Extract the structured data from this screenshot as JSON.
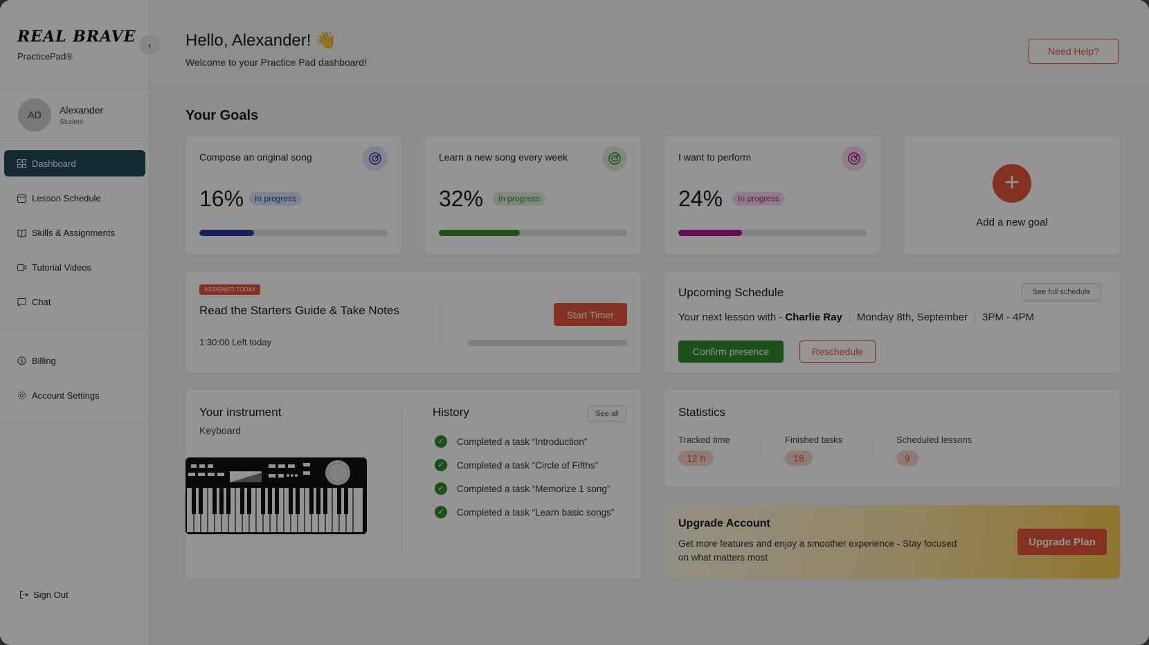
{
  "brand": {
    "logo": "REAL BRAVE",
    "product": "PracticePad®"
  },
  "user": {
    "initials": "AD",
    "name": "Alexander",
    "role": "Student"
  },
  "nav": {
    "items": [
      {
        "label": "Dashboard",
        "icon": "dashboard-icon",
        "active": true
      },
      {
        "label": "Lesson Schedule",
        "icon": "calendar-icon"
      },
      {
        "label": "Skills & Assignments",
        "icon": "book-icon"
      },
      {
        "label": "Tutorial Videos",
        "icon": "video-icon"
      },
      {
        "label": "Chat",
        "icon": "chat-icon"
      }
    ],
    "secondary": [
      {
        "label": "Billing",
        "icon": "billing-icon"
      },
      {
        "label": "Account Settings",
        "icon": "gear-icon"
      }
    ],
    "signout": "Sign Out"
  },
  "header": {
    "greeting": "Hello, Alexander! 👋",
    "welcome": "Welcome to your Practice Pad dashboard!",
    "help_label": "Need Help?"
  },
  "goals": {
    "title": "Your Goals",
    "items": [
      {
        "title": "Compose an original song",
        "percent_label": "16%",
        "progress": 0.29,
        "status": "In progress",
        "color": "#2b3a9e",
        "badge_bg": "#dfe3f6",
        "icon_bg": "#dfe3f6"
      },
      {
        "title": "Learn a new song every week",
        "percent_label": "32%",
        "progress": 0.43,
        "status": "In progress",
        "color": "#3a8a2a",
        "badge_bg": "#dcedd6",
        "icon_bg": "#dcedd6"
      },
      {
        "title": "I want to perform",
        "percent_label": "24%",
        "progress": 0.34,
        "status": "In progress",
        "color": "#b0178f",
        "badge_bg": "#f5d8ee",
        "icon_bg": "#f5d8ee"
      }
    ],
    "add_label": "Add a new goal"
  },
  "assignment": {
    "tag": "ASSIGNED TODAY",
    "title": "Read the Starters Guide & Take Notes",
    "time_left": "1:30:00 Left today",
    "timer_label": "Start Timer"
  },
  "schedule": {
    "title": "Upcoming Schedule",
    "link_label": "See full schedule",
    "prefix": "Your next lesson with -",
    "teacher": "Charlie Ray",
    "date": "Monday 8th, September",
    "time": "3PM - 4PM",
    "confirm_label": "Confirm presence",
    "reschedule_label": "Reschedule"
  },
  "instrument": {
    "title": "Your instrument",
    "name": "Keyboard"
  },
  "history": {
    "title": "History",
    "link_label": "See all",
    "items": [
      "Completed a task “Introduction”",
      "Completed a task “Circle of Fifths”",
      "Completed a task “Memorize 1 song”",
      "Completed a task “Learn basic songs”"
    ]
  },
  "statistics": {
    "title": "Statistics",
    "items": [
      {
        "label": "Tracked time",
        "value": "12 h"
      },
      {
        "label": "Finished tasks",
        "value": "18"
      },
      {
        "label": "Scheduled lessons",
        "value": "9"
      }
    ]
  },
  "upgrade": {
    "title": "Upgrade Account",
    "text": "Get more features and enjoy a smoother experience - Stay focused on what matters most",
    "button_label": "Upgrade Plan"
  },
  "colors": {
    "accent": "#e4553b",
    "nav_active": "#1f4a57",
    "success": "#2f8a2f"
  }
}
